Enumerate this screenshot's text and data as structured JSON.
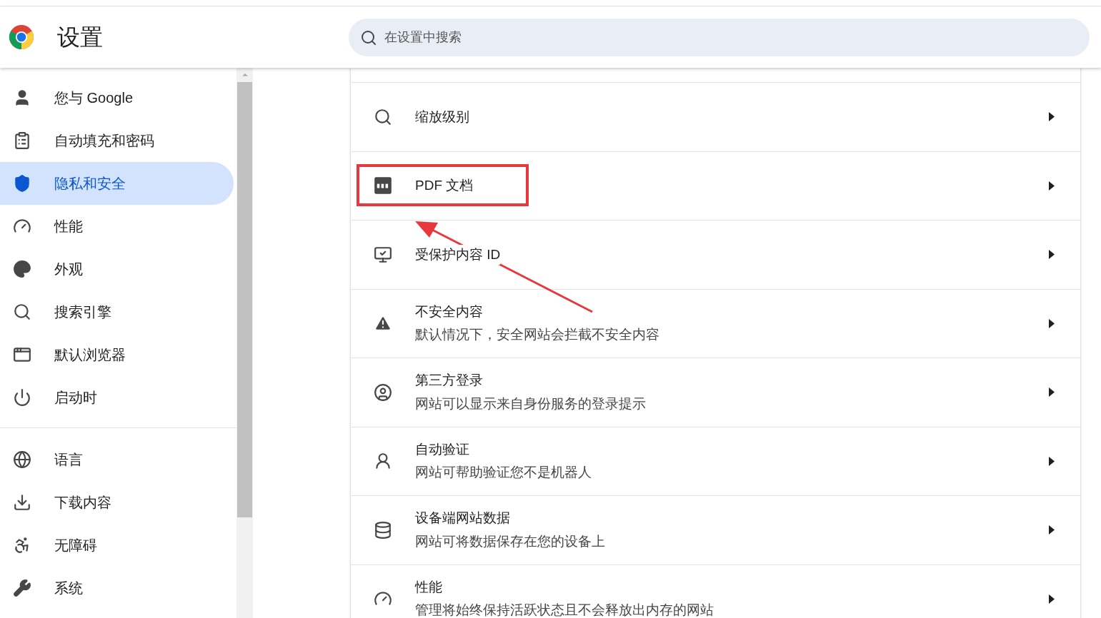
{
  "header": {
    "title": "设置",
    "search": {
      "placeholder": "在设置中搜索"
    }
  },
  "sidebar": {
    "groups": [
      {
        "items": [
          {
            "label": "您与 Google",
            "selected": false
          },
          {
            "label": "自动填充和密码",
            "selected": false
          },
          {
            "label": "隐私和安全",
            "selected": true
          },
          {
            "label": "性能",
            "selected": false
          },
          {
            "label": "外观",
            "selected": false
          },
          {
            "label": "搜索引擎",
            "selected": false
          },
          {
            "label": "默认浏览器",
            "selected": false
          },
          {
            "label": "启动时",
            "selected": false
          }
        ]
      },
      {
        "items": [
          {
            "label": "语言",
            "selected": false
          },
          {
            "label": "下载内容",
            "selected": false
          },
          {
            "label": "无障碍",
            "selected": false
          },
          {
            "label": "系统",
            "selected": false
          }
        ]
      }
    ]
  },
  "settings": [
    {
      "title": "缩放级别"
    },
    {
      "title": "PDF 文档",
      "highlighted": true
    },
    {
      "title": "受保护内容 ID"
    },
    {
      "title": "不安全内容",
      "subtitle": "默认情况下，安全网站会拦截不安全内容"
    },
    {
      "title": "第三方登录",
      "subtitle": "网站可以显示来自身份服务的登录提示"
    },
    {
      "title": "自动验证",
      "subtitle": "网站可帮助验证您不是机器人"
    },
    {
      "title": "设备端网站数据",
      "subtitle": "网站可将数据保存在您的设备上"
    },
    {
      "title": "性能",
      "subtitle": "管理将始终保持活跃状态且不会释放出内存的网站"
    }
  ]
}
